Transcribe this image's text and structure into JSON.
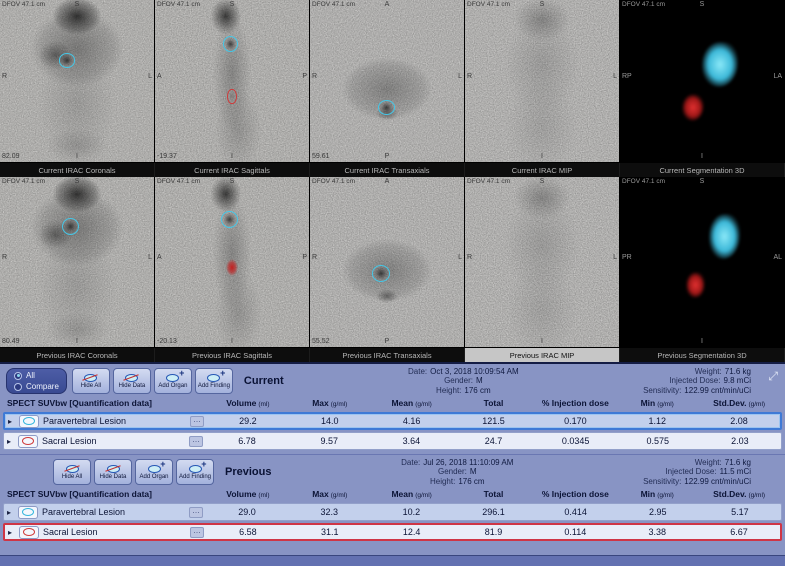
{
  "colors": {
    "lesion_cyan": "#45c6e6",
    "lesion_red": "#cf3a3a",
    "panel_background": "#8894c4",
    "selection_blue": "#3f7ad6",
    "selection_red": "#cf3545"
  },
  "icons": {
    "expand": "⤢",
    "row_expander": "▸",
    "more_options": "…"
  },
  "viewports": {
    "rows": [
      {
        "id": "current",
        "panels": [
          {
            "kind": "coronal",
            "dfov": "DFOV 47.1 cm",
            "top": "S",
            "left": "R",
            "right": "L",
            "bottom": "I",
            "pos": "82.09",
            "tab": "Current IRAC Coronals",
            "tab_selected": false
          },
          {
            "kind": "sagittal",
            "dfov": "DFOV 47.1 cm",
            "top": "S",
            "left": "A",
            "right": "P",
            "bottom": "I",
            "pos": "-19.37",
            "tab": "Current IRAC Sagittals",
            "tab_selected": false
          },
          {
            "kind": "transaxial",
            "dfov": "DFOV 47.1 cm",
            "top": "A",
            "left": "R",
            "right": "L",
            "bottom": "P",
            "pos": "59.61",
            "tab": "Current IRAC Transaxials",
            "tab_selected": false
          },
          {
            "kind": "mip",
            "dfov": "DFOV 47.1 cm",
            "top": "S",
            "left": "R",
            "right": "L",
            "bottom": "I",
            "pos": "",
            "tab": "Current IRAC MIP",
            "tab_selected": false
          },
          {
            "kind": "seg3d",
            "dfov": "DFOV 47.1 cm",
            "top": "S",
            "left": "RP",
            "right": "LA",
            "bottom": "I",
            "pos": "",
            "tab": "Current Segmentation 3D",
            "tab_selected": false
          }
        ]
      },
      {
        "id": "previous",
        "panels": [
          {
            "kind": "coronal",
            "dfov": "DFOV 47.1 cm",
            "top": "S",
            "left": "R",
            "right": "L",
            "bottom": "I",
            "pos": "80.49",
            "tab": "Previous IRAC Coronals",
            "tab_selected": false
          },
          {
            "kind": "sagittal",
            "dfov": "DFOV 47.1 cm",
            "top": "S",
            "left": "A",
            "right": "P",
            "bottom": "I",
            "pos": "-20.13",
            "tab": "Previous IRAC Sagittals",
            "tab_selected": false
          },
          {
            "kind": "transaxial",
            "dfov": "DFOV 47.1 cm",
            "top": "A",
            "left": "R",
            "right": "L",
            "bottom": "P",
            "pos": "55.52",
            "tab": "Previous IRAC Transaxials",
            "tab_selected": false
          },
          {
            "kind": "mip",
            "dfov": "DFOV 47.1 cm",
            "top": "S",
            "left": "R",
            "right": "L",
            "bottom": "I",
            "pos": "",
            "tab": "Previous IRAC MIP",
            "tab_selected": true
          },
          {
            "kind": "seg3d",
            "dfov": "DFOV 47.1 cm",
            "top": "S",
            "left": "PR",
            "right": "AL",
            "bottom": "I",
            "pos": "",
            "tab": "Previous Segmentation 3D",
            "tab_selected": false
          }
        ]
      }
    ]
  },
  "quant": {
    "view_toggle": {
      "options": [
        {
          "label": "All",
          "selected": true
        },
        {
          "label": "Compare",
          "selected": false
        }
      ]
    },
    "sections": [
      {
        "id": "current",
        "title": "Current",
        "has_toggle": true,
        "has_expand": true,
        "buttons": [
          {
            "label": "Hide All",
            "type": "hide"
          },
          {
            "label": "Hide Data",
            "type": "hide"
          },
          {
            "label": "Add Organ",
            "type": "add"
          },
          {
            "label": "Add Finding",
            "type": "add"
          }
        ],
        "meta_center": [
          {
            "label": "Date:",
            "value": "Oct 3, 2018 10:09:54 AM"
          },
          {
            "label": "Gender:",
            "value": "M"
          },
          {
            "label": "Height:",
            "value": "176 cm"
          }
        ],
        "meta_right": [
          {
            "label": "Weight:",
            "value": "71.6 kg"
          },
          {
            "label": "Injected Dose:",
            "value": "9.8 mCi"
          },
          {
            "label": "Sensitivity:",
            "value": "122.99 cnt/min/uCi"
          }
        ],
        "table": {
          "title": "SPECT SUVbw [Quantification data]",
          "columns": [
            {
              "label": "Volume",
              "unit": "(ml)"
            },
            {
              "label": "Max",
              "unit": "(g/ml)"
            },
            {
              "label": "Mean",
              "unit": "(g/ml)"
            },
            {
              "label": "Total",
              "unit": ""
            },
            {
              "label": "% Injection dose",
              "unit": ""
            },
            {
              "label": "Min",
              "unit": "(g/ml)"
            },
            {
              "label": "Std.Dev.",
              "unit": "(g/ml)"
            }
          ],
          "rows": [
            {
              "name": "Paravertebral Lesion",
              "lesion_color": "cyan",
              "selection": "blue",
              "values": [
                "29.2",
                "14.0",
                "4.16",
                "121.5",
                "0.170",
                "1.12",
                "2.08"
              ]
            },
            {
              "name": "Sacral Lesion",
              "lesion_color": "red",
              "selection": "none",
              "values": [
                "6.78",
                "9.57",
                "3.64",
                "24.7",
                "0.0345",
                "0.575",
                "2.03"
              ]
            }
          ]
        }
      },
      {
        "id": "previous",
        "title": "Previous",
        "has_toggle": false,
        "has_expand": false,
        "buttons": [
          {
            "label": "Hide All",
            "type": "hide"
          },
          {
            "label": "Hide Data",
            "type": "hide"
          },
          {
            "label": "Add Organ",
            "type": "add"
          },
          {
            "label": "Add Finding",
            "type": "add"
          }
        ],
        "meta_center": [
          {
            "label": "Date:",
            "value": "Jul 26, 2018 11:10:09 AM"
          },
          {
            "label": "Gender:",
            "value": "M"
          },
          {
            "label": "Height:",
            "value": "176 cm"
          }
        ],
        "meta_right": [
          {
            "label": "Weight:",
            "value": "71.6 kg"
          },
          {
            "label": "Injected Dose:",
            "value": "11.5 mCi"
          },
          {
            "label": "Sensitivity:",
            "value": "122.99 cnt/min/uCi"
          }
        ],
        "table": {
          "title": "SPECT SUVbw [Quantification data]",
          "columns": [
            {
              "label": "Volume",
              "unit": "(ml)"
            },
            {
              "label": "Max",
              "unit": "(g/ml)"
            },
            {
              "label": "Mean",
              "unit": "(g/ml)"
            },
            {
              "label": "Total",
              "unit": ""
            },
            {
              "label": "% Injection dose",
              "unit": ""
            },
            {
              "label": "Min",
              "unit": "(g/ml)"
            },
            {
              "label": "Std.Dev.",
              "unit": "(g/ml)"
            }
          ],
          "rows": [
            {
              "name": "Paravertebral Lesion",
              "lesion_color": "cyan",
              "selection": "none",
              "values": [
                "29.0",
                "32.3",
                "10.2",
                "296.1",
                "0.414",
                "2.95",
                "5.17"
              ]
            },
            {
              "name": "Sacral Lesion",
              "lesion_color": "red",
              "selection": "red",
              "values": [
                "6.58",
                "31.1",
                "12.4",
                "81.9",
                "0.114",
                "3.38",
                "6.67"
              ]
            }
          ]
        }
      }
    ]
  }
}
